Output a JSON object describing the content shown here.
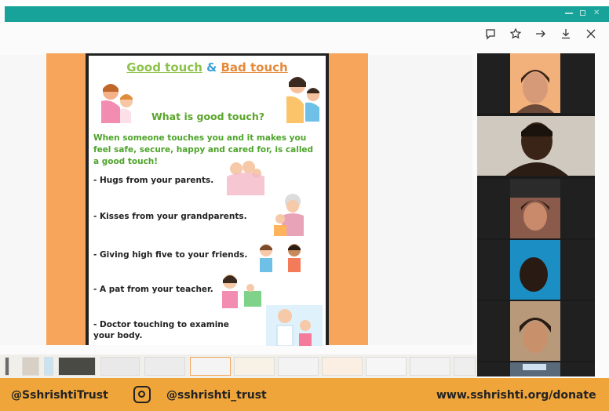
{
  "toolbar": {
    "icons": [
      "comment-icon",
      "star-icon",
      "arrow-right-icon",
      "download-icon",
      "close-icon"
    ]
  },
  "slide": {
    "title_good": "Good touch",
    "title_amp": "&",
    "title_bad": "Bad touch",
    "subheading": "What is good touch?",
    "intro": "When someone touches you and it makes you feel safe, secure, happy and cared for, is called a good touch!",
    "items": [
      "- Hugs from your parents.",
      "- Kisses from your grandparents.",
      "- Giving high five to your friends.",
      "- A pat from your teacher.",
      "- Doctor touching to examine your body."
    ]
  },
  "footer": {
    "twitter": "@SshrishtiTrust",
    "instagram": "@sshrishti_trust",
    "donate": "www.sshrishti.org/donate"
  },
  "colors": {
    "teal_bar": "#17a39a",
    "slide_orange": "#f6a55a",
    "footer_orange": "#efa53a"
  }
}
